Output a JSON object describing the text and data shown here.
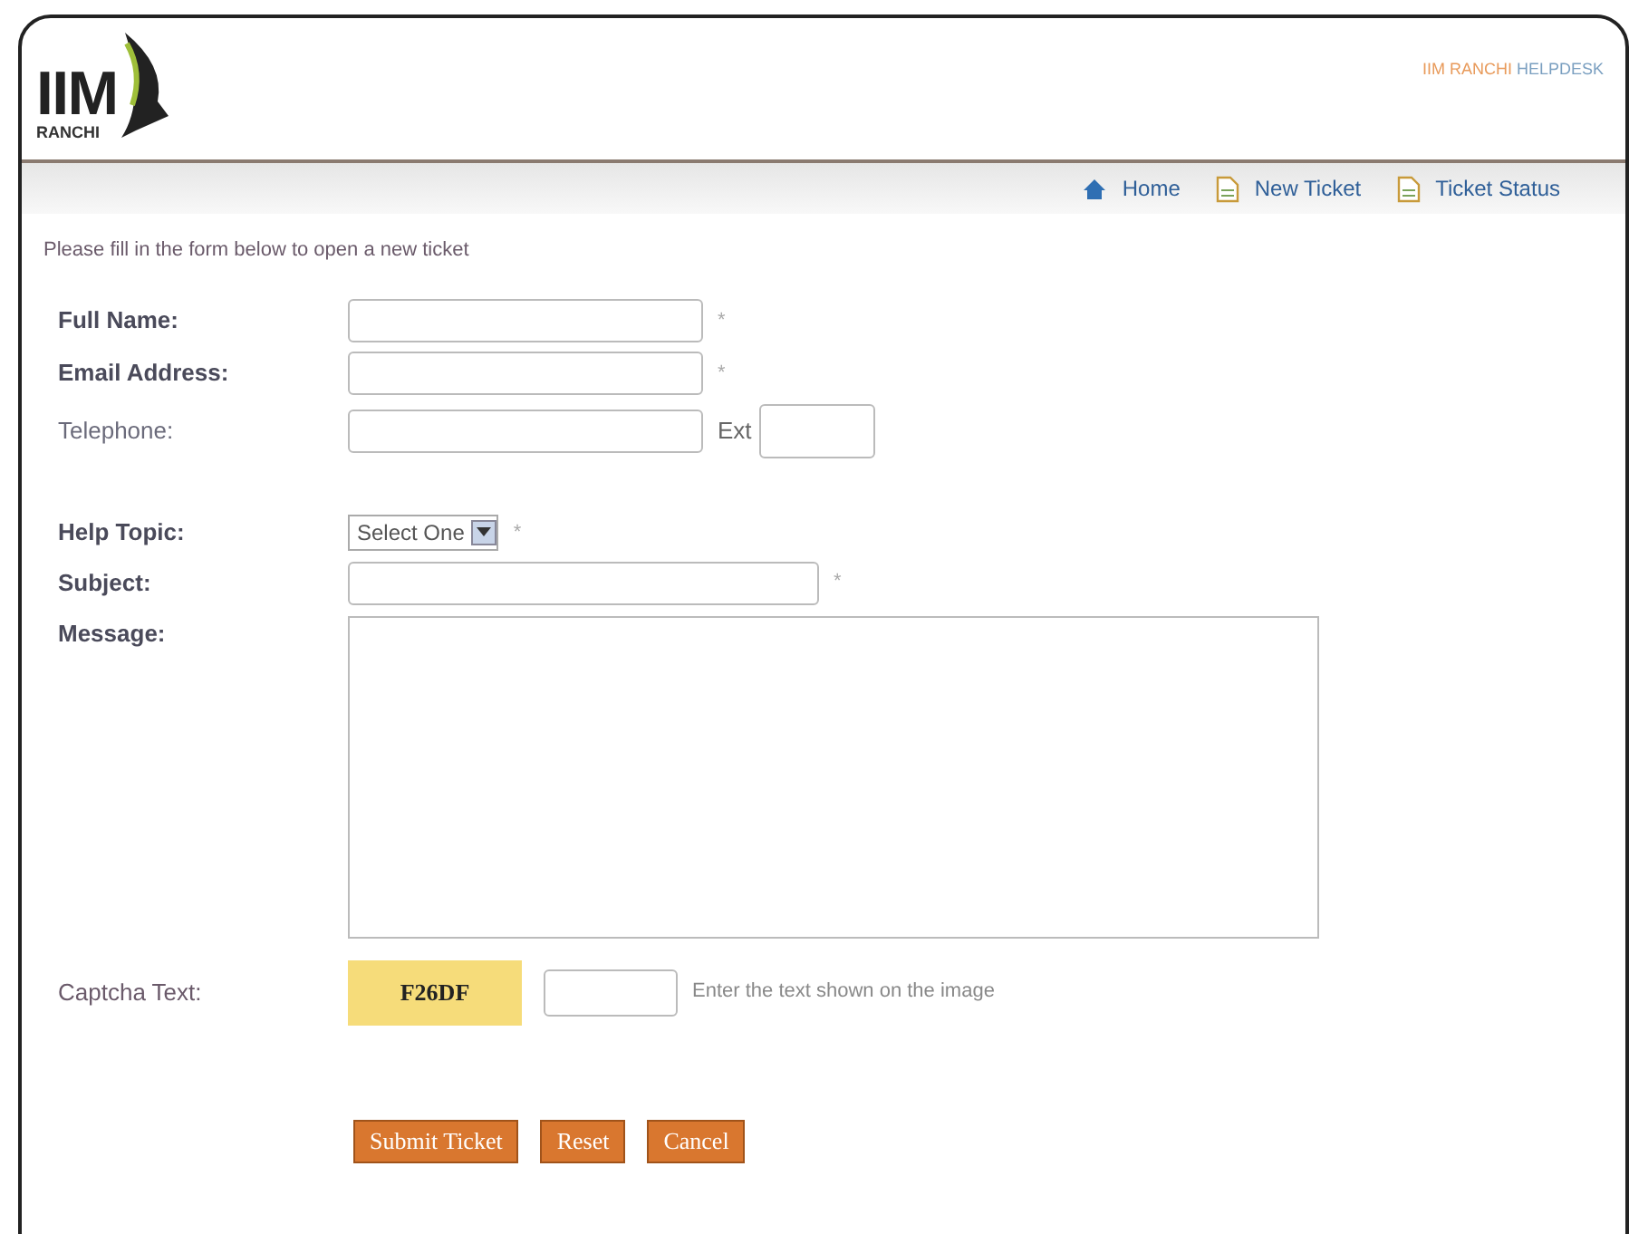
{
  "logo": {
    "mark": "IIM",
    "city": "RANCHI"
  },
  "site_title": {
    "first": "IIM RANCHI",
    "second": "HELPDESK"
  },
  "nav": [
    {
      "label": "Home"
    },
    {
      "label": "New Ticket"
    },
    {
      "label": "Ticket Status"
    }
  ],
  "intro": "Please fill in the form below to open a new ticket",
  "fields": [
    {
      "kind": "text",
      "label": "Full Name:",
      "bold": true,
      "required": "*"
    },
    {
      "kind": "text",
      "label": "Email Address:",
      "bold": true,
      "required": "*"
    },
    {
      "kind": "phone",
      "label": "Telephone:",
      "bold": false,
      "ext": "Ext"
    },
    {
      "kind": "spacer"
    },
    {
      "kind": "select",
      "label": "Help Topic:",
      "bold": true,
      "value": "Select One",
      "required": "*"
    },
    {
      "kind": "wide",
      "label": "Subject:",
      "bold": true,
      "required": "*"
    },
    {
      "kind": "textarea",
      "label": "Message:",
      "bold": true
    }
  ],
  "captcha": {
    "label": "Captcha Text:",
    "code": "F26DF",
    "hint": "Enter the text shown on the image"
  },
  "buttons": [
    "Submit Ticket",
    "Reset",
    "Cancel"
  ]
}
